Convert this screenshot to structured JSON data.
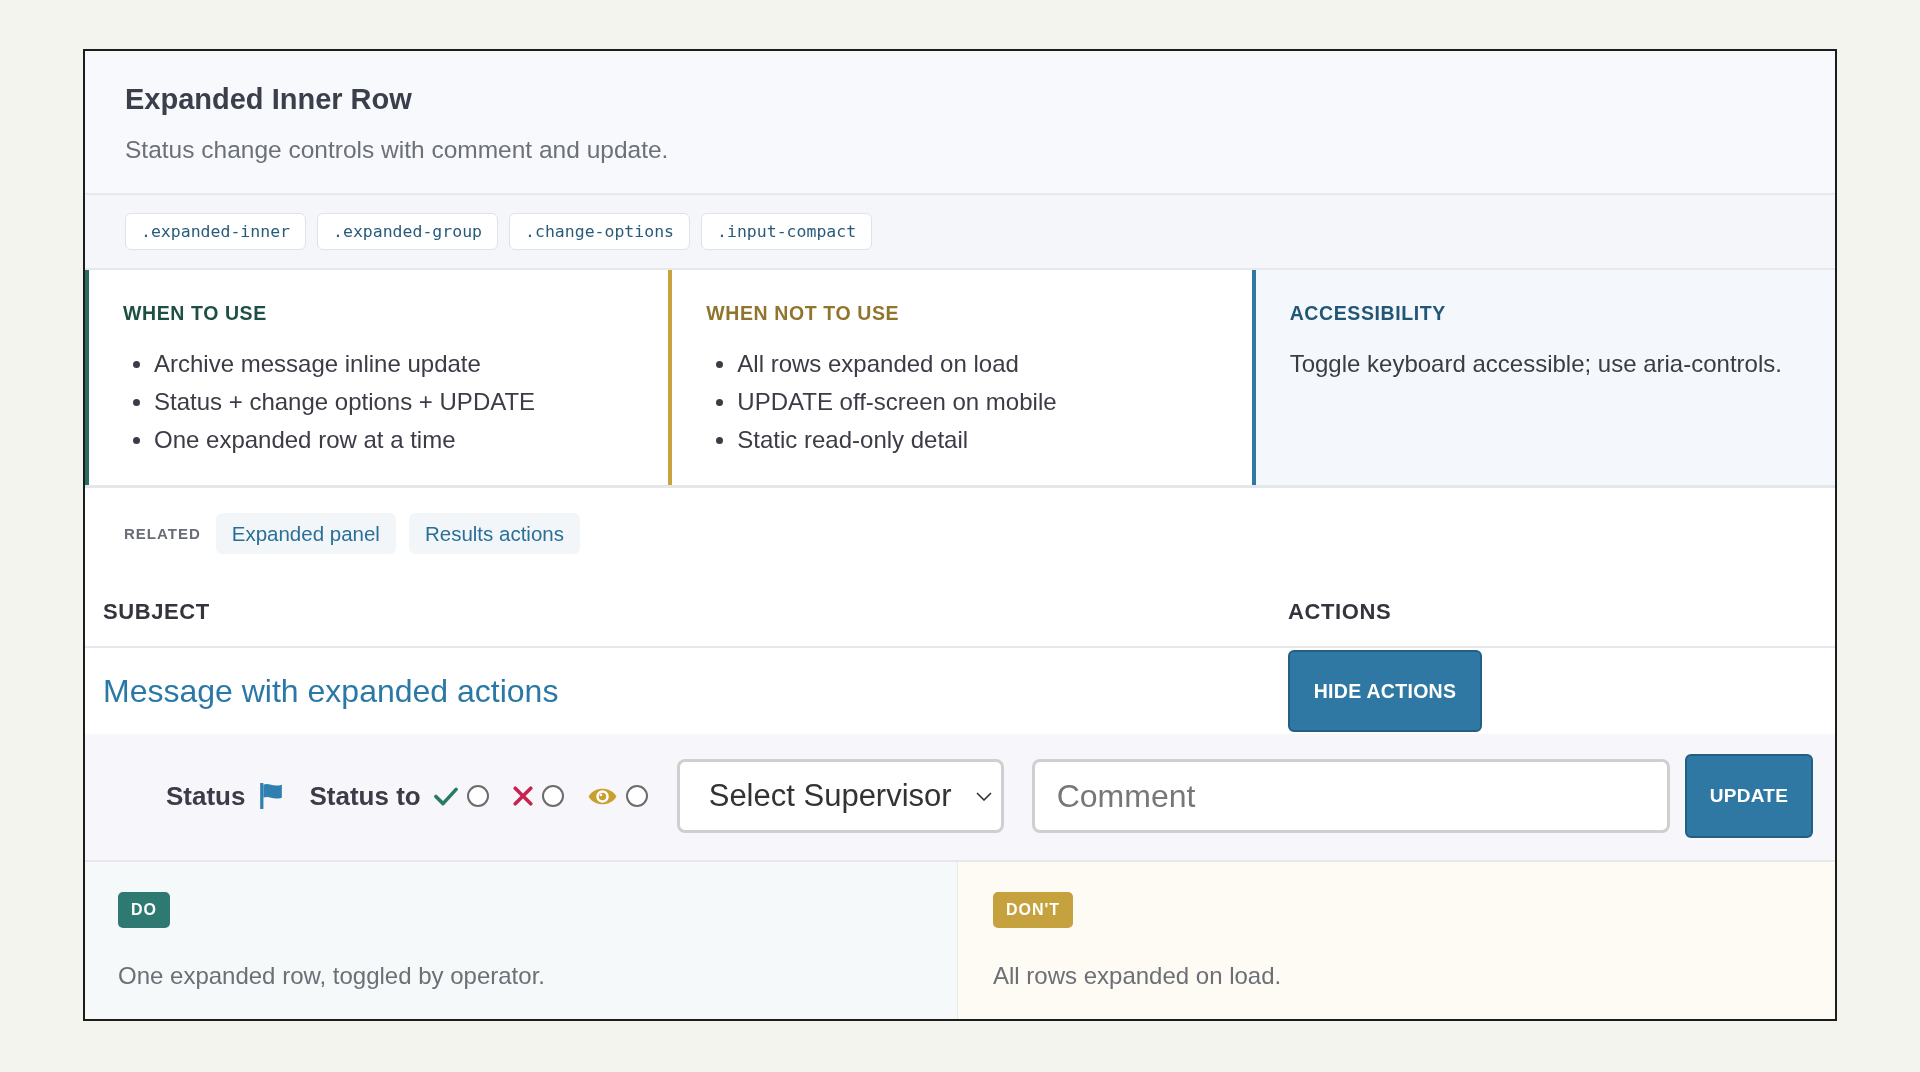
{
  "header": {
    "title": "Expanded Inner Row",
    "subtitle": "Status change controls with comment and update."
  },
  "class_tags": [
    ".expanded-inner",
    ".expanded-group",
    ".change-options",
    ".input-compact"
  ],
  "guidance": [
    {
      "kind": "list",
      "heading": "WHEN TO USE",
      "color": "#2a6e60",
      "items": [
        "Archive message inline update",
        "Status + change options + UPDATE",
        "One expanded row at a time"
      ]
    },
    {
      "kind": "list",
      "heading": "WHEN NOT TO USE",
      "color": "#c8a33e",
      "items": [
        "All rows expanded on load",
        "UPDATE off-screen on mobile",
        "Static read-only detail"
      ]
    },
    {
      "kind": "note",
      "heading": "ACCESSIBILITY",
      "color": "#2f78a3",
      "text": "Toggle keyboard accessible; use aria-controls."
    }
  ],
  "related": {
    "label": "RELATED",
    "links": [
      "Expanded panel",
      "Results actions"
    ]
  },
  "table": {
    "columns": [
      "SUBJECT",
      "ACTIONS"
    ],
    "rows": [
      {
        "subject": "Message with expanded actions",
        "action": "HIDE ACTIONS",
        "expanded": true,
        "detail": {
          "status_label": "Status",
          "status_to_label": "Status to",
          "options": [
            {
              "kind": "approve",
              "color": "#2a7a68",
              "selected": false
            },
            {
              "kind": "reject",
              "color": "#c8234f",
              "selected": false
            },
            {
              "kind": "review",
              "color": "#c9a030",
              "selected": false
            }
          ],
          "supervisor": {
            "value": "Select Supervisor"
          },
          "comment": {
            "placeholder": "Comment"
          },
          "submit": "UPDATE"
        }
      }
    ]
  },
  "examples": [
    {
      "kind": "do",
      "badge": "DO",
      "text": "One expanded row, toggled by operator."
    },
    {
      "kind": "dont",
      "badge": "DON'T",
      "text": "All rows expanded on load."
    }
  ]
}
